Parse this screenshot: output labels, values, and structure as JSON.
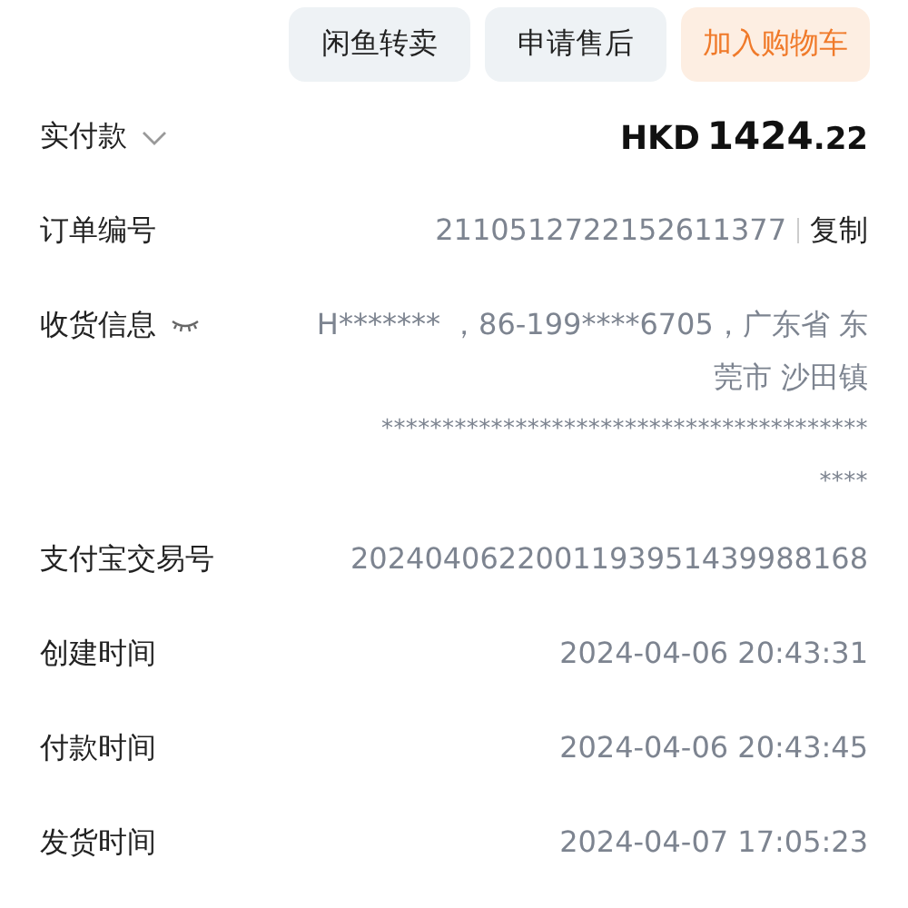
{
  "actions": [
    {
      "label": "闲鱼转卖",
      "kind": "plain"
    },
    {
      "label": "申请售后",
      "kind": "plain"
    },
    {
      "label": "加入购物车",
      "kind": "primary"
    }
  ],
  "payment": {
    "label": "实付款",
    "expanded": false,
    "currency": "HKD",
    "integer": "1424",
    "decimal": ".22"
  },
  "order_number": {
    "label": "订单编号",
    "value": "2110512722152611377",
    "action": "复制"
  },
  "shipping": {
    "label": "收货信息",
    "revealed": false,
    "lines": [
      "H******* ，86-199****6705，广东省 东",
      "莞市 沙田镇",
      "****************************************",
      "****"
    ]
  },
  "details": [
    {
      "label": "支付宝交易号",
      "value": "2024040622001193951439988168"
    },
    {
      "label": "创建时间",
      "value": "2024-04-06 20:43:31"
    },
    {
      "label": "付款时间",
      "value": "2024-04-06 20:43:45"
    },
    {
      "label": "发货时间",
      "value": "2024-04-07 17:05:23"
    }
  ]
}
